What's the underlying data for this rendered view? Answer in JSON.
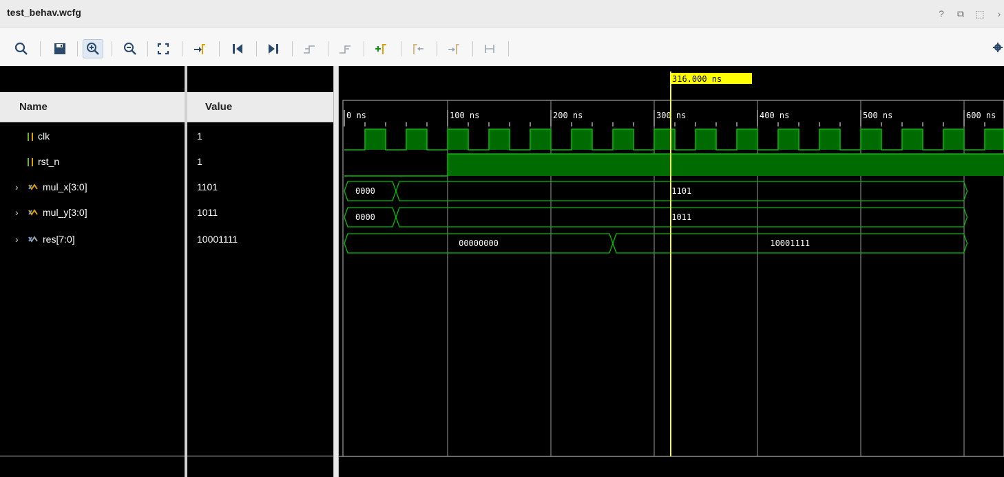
{
  "window": {
    "title": "test_behav.wcfg",
    "controls": [
      "?",
      "⧉",
      "⬚",
      "›"
    ]
  },
  "toolbar": {
    "buttons": [
      {
        "name": "search-icon",
        "glyph": "🔍"
      },
      {
        "name": "save-icon",
        "glyph": "💾"
      },
      {
        "name": "zoom-in-icon",
        "glyph": "⊕"
      },
      {
        "name": "zoom-out-icon",
        "glyph": "⊖"
      },
      {
        "name": "zoom-fit-icon",
        "glyph": "⛶"
      },
      {
        "name": "go-to-cursor-icon",
        "glyph": "⇥"
      },
      {
        "name": "go-to-time-0-icon",
        "glyph": "⏮"
      },
      {
        "name": "go-to-last-time-icon",
        "glyph": "⏭"
      },
      {
        "name": "previous-transition-icon",
        "glyph": "↤"
      },
      {
        "name": "next-transition-icon",
        "glyph": "↦"
      },
      {
        "name": "add-marker-icon",
        "glyph": "+"
      },
      {
        "name": "previous-marker-icon",
        "glyph": "⇤"
      },
      {
        "name": "next-marker-icon",
        "glyph": "⇥"
      },
      {
        "name": "swap-cursors-icon",
        "glyph": "⊢⊣"
      }
    ]
  },
  "columns": {
    "name_header": "Name",
    "value_header": "Value"
  },
  "signals": [
    {
      "name": "clk",
      "value": "1",
      "kind": "bit",
      "expandable": false
    },
    {
      "name": "rst_n",
      "value": "1",
      "kind": "bit",
      "expandable": false
    },
    {
      "name": "mul_x[3:0]",
      "value": "1101",
      "kind": "bus",
      "expandable": true
    },
    {
      "name": "mul_y[3:0]",
      "value": "1011",
      "kind": "bus",
      "expandable": true
    },
    {
      "name": "res[7:0]",
      "value": "10001111",
      "kind": "bus",
      "expandable": true
    }
  ],
  "timeline": {
    "cursor_label": "316.000 ns",
    "cursor_time_ns": 316,
    "time_range_ns": [
      -1,
      603
    ],
    "major_ticks": [
      {
        "t": 0,
        "label": "0 ns"
      },
      {
        "t": 100,
        "label": "100 ns"
      },
      {
        "t": 200,
        "label": "200 ns"
      },
      {
        "t": 300,
        "label": "300 ns"
      },
      {
        "t": 400,
        "label": "400 ns"
      },
      {
        "t": 500,
        "label": "500 ns"
      },
      {
        "t": 600,
        "label": "600 ns"
      }
    ]
  },
  "waveforms": {
    "clk_period_ns": 40,
    "clk_first_rise_ns": 20,
    "rst_n_rise_ns": 100,
    "mul_x": [
      {
        "from": 0,
        "to": 50,
        "value": "0000"
      },
      {
        "from": 50,
        "to": 603,
        "value": "1101"
      }
    ],
    "mul_y": [
      {
        "from": 0,
        "to": 50,
        "value": "0000"
      },
      {
        "from": 50,
        "to": 603,
        "value": "1011"
      }
    ],
    "res": [
      {
        "from": 0,
        "to": 260,
        "value": "00000000"
      },
      {
        "from": 260,
        "to": 603,
        "value": "10001111"
      }
    ]
  },
  "colors": {
    "wave": "#00c000",
    "wave_fill": "#006b00",
    "cursor": "#ffff00",
    "grid": "#9a9a9a"
  }
}
